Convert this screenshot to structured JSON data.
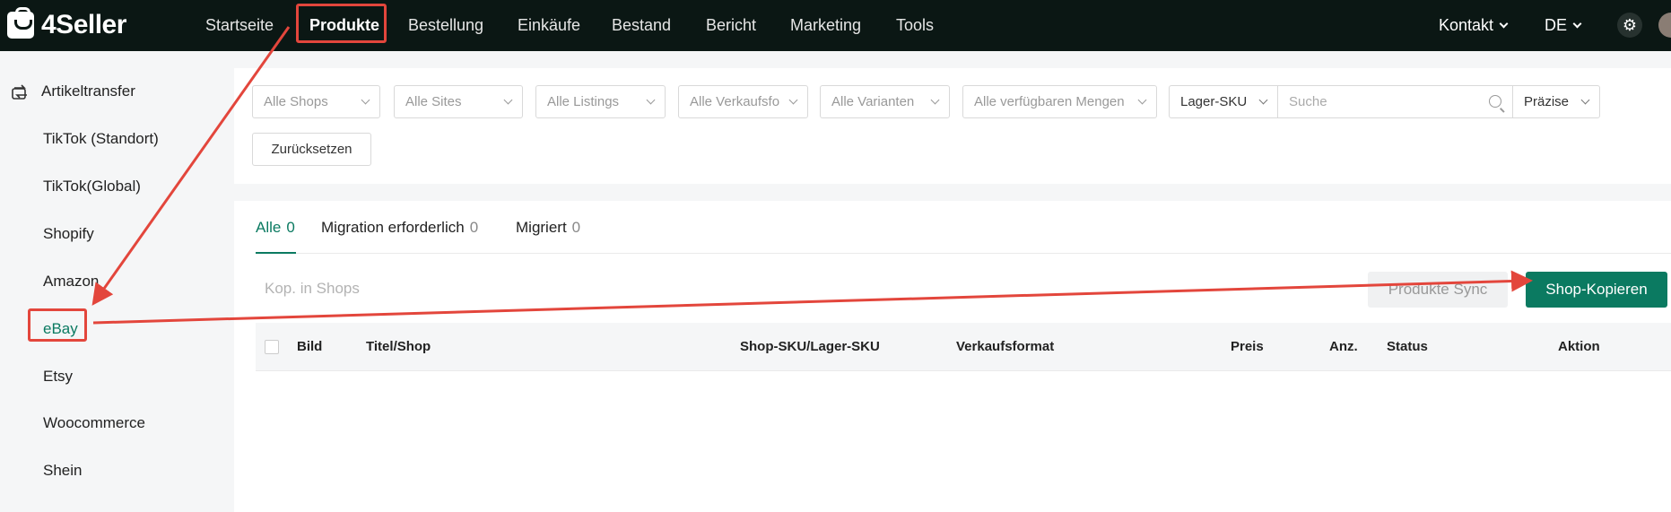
{
  "brand": {
    "name": "4Seller"
  },
  "topnav": {
    "items": [
      "Startseite",
      "Produkte",
      "Bestellung",
      "Einkäufe",
      "Bestand",
      "Bericht",
      "Marketing",
      "Tools"
    ],
    "active": "Produkte",
    "contact": "Kontakt",
    "language": "DE",
    "settings_icon": "gear-icon"
  },
  "sidebar": {
    "header": "Artikeltransfer",
    "header_icon": "transfer-icon",
    "items": [
      "TikTok (Standort)",
      "TikTok(Global)",
      "Shopify",
      "Amazon",
      "eBay",
      "Etsy",
      "Woocommerce",
      "Shein"
    ],
    "active": "eBay"
  },
  "filters": {
    "shops": "Alle Shops",
    "sites": "Alle Sites",
    "listings": "Alle Listings",
    "sales_format": "Alle Verkaufsfo",
    "variants": "Alle Varianten",
    "quantities": "Alle verfügbaren Mengen",
    "sku_type": "Lager-SKU",
    "search_placeholder": "Suche",
    "match": "Präzise",
    "reset": "Zurücksetzen"
  },
  "tabs": [
    {
      "label": "Alle",
      "count": "0"
    },
    {
      "label": "Migration erforderlich",
      "count": "0"
    },
    {
      "label": "Migriert",
      "count": "0"
    }
  ],
  "toolbar": {
    "shop_filter_placeholder": "Kop. in Shops",
    "sync_button": "Produkte Sync",
    "copy_button": "Shop-Kopieren"
  },
  "table": {
    "columns": [
      "Bild",
      "Titel/Shop",
      "Shop-SKU/Lager-SKU",
      "Verkaufsformat",
      "Preis",
      "Anz.",
      "Status",
      "Aktion"
    ]
  },
  "colors": {
    "topbar": "#0b1714",
    "accent": "#0b7a61",
    "annotation": "#e3463c"
  }
}
